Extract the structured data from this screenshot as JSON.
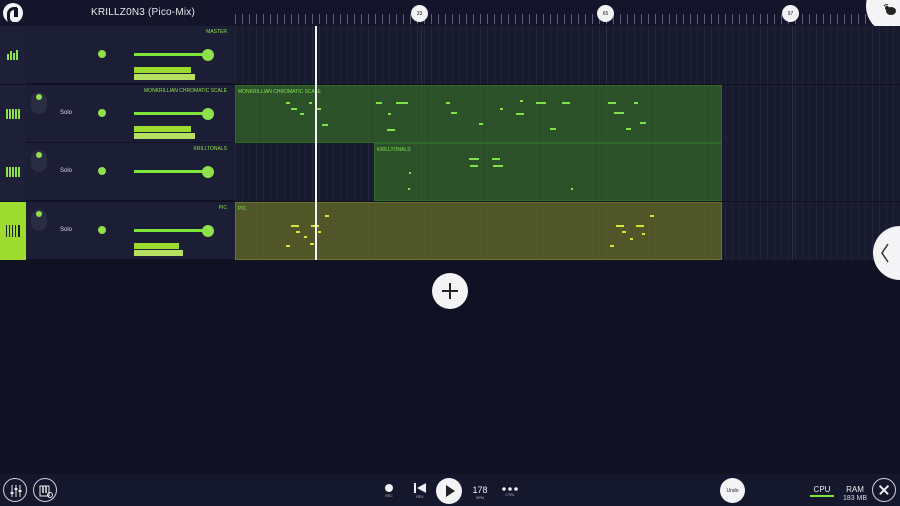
{
  "app": {
    "song_title": "KRILLZ0N3 (Pico-Mix)",
    "bar_markers": [
      "33",
      "65",
      "97"
    ]
  },
  "colors": {
    "accent": "#8fe04a",
    "clip_green": "#346628",
    "clip_olive": "#606826",
    "background": "#101122"
  },
  "tracks": [
    {
      "name": "MASTER",
      "icon": "meter-bars-icon",
      "has_solo": false,
      "active": false,
      "clip_label": ""
    },
    {
      "name": "MONKRILLIAN CHROMATIC SCALE",
      "icon": "piano-roll-icon",
      "solo_label": "Solo",
      "has_solo": true,
      "active": false,
      "clip_label": "MONKRILLIAN CHROMATIC SCALE"
    },
    {
      "name": "KRILLTONALS",
      "icon": "piano-roll-icon",
      "solo_label": "Solo",
      "has_solo": true,
      "active": false,
      "clip_label": "KRILLTONALS"
    },
    {
      "name": "PIC",
      "icon": "piano-keys-icon",
      "solo_label": "Solo",
      "has_solo": true,
      "active": true,
      "clip_label": "PIC"
    }
  ],
  "transport": {
    "rec_label": "REC",
    "rev_label": "REV",
    "bpm_value": "178",
    "bpm_label": "BPM",
    "ctrl_label": "CTRL",
    "undo_label": "Undo"
  },
  "status": {
    "cpu_label": "CPU",
    "ram_label": "RAM",
    "ram_value": "183 MB"
  }
}
